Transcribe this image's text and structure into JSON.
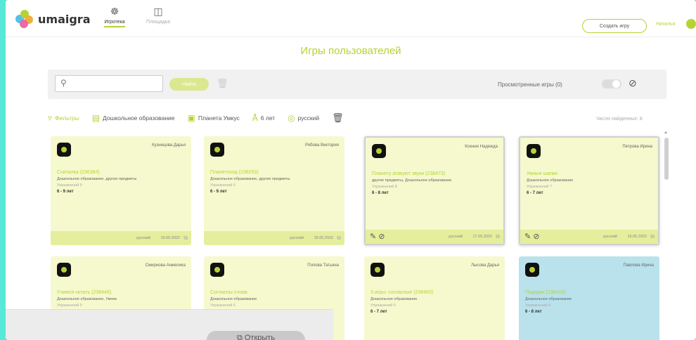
{
  "app": {
    "name": "umaigra"
  },
  "nav": [
    {
      "label": "Игротека",
      "icon": "games-icon"
    },
    {
      "label": "Площадка",
      "icon": "board-icon"
    }
  ],
  "header": {
    "create_button": "Создать игру",
    "user_name": "Наталья"
  },
  "page": {
    "title": "Игры пользователей"
  },
  "search": {
    "placeholder": "",
    "find_label": "Найти",
    "viewed_label": "Просмотренные игры (0)"
  },
  "filters": [
    {
      "label": "Фильтры",
      "icon": "funnel-icon",
      "accent": true
    },
    {
      "label": "Дошкольное образование",
      "icon": "book-icon",
      "accent": false
    },
    {
      "label": "Планета Умкус",
      "icon": "planet-icon",
      "accent": false
    },
    {
      "label": "6 лет",
      "icon": "age-icon",
      "accent": false
    },
    {
      "label": "русский",
      "icon": "globe-icon",
      "accent": false
    }
  ],
  "results_label": "Число найденных: 8",
  "cards": [
    {
      "author": "Кузнецова Дарья",
      "title": "Считалка (236384)",
      "subject": "Дошкольное образование, другие предметы",
      "exercises": "Упражнений 5",
      "age": "6 - 9 лет",
      "lang": "русский",
      "date": "19.05.2022",
      "selected": false,
      "color": "yellow"
    },
    {
      "author": "Рябова Виктория",
      "title": "Планетоход (238253)",
      "subject": "Дошкольное образование, другие предметы",
      "exercises": "Упражнений 6",
      "age": "6 - 9 лет",
      "lang": "русский",
      "date": "18.05.2022",
      "selected": false,
      "color": "yellow"
    },
    {
      "author": "Ксения Надежда",
      "title": "Планету атакуют звуки (238473)",
      "subject": "другие предметы, Дошкольное образование",
      "exercises": "Упражнений 8",
      "age": "6 - 8 лет",
      "lang": "русский",
      "date": "17.05.2022",
      "selected": true,
      "color": "yellow"
    },
    {
      "author": "Петрова Ирина",
      "title": "Умные шапки",
      "subject": "Дошкольное образование",
      "exercises": "Упражнений 7",
      "age": "6 - 7 лет",
      "lang": "русский",
      "date": "16.05.2022",
      "selected": true,
      "color": "yellow"
    },
    {
      "author": "Смирнова Анжелика",
      "title": "Учимся читать (238446)",
      "subject": "Дошкольное образование, Умник",
      "exercises": "Упражнений 5",
      "age": "",
      "lang": "",
      "date": "",
      "selected": false,
      "color": "yellow"
    },
    {
      "author": "Попова Татьяна",
      "title": "Согласны слова",
      "subject": "Дошкольное образование",
      "exercises": "Упражнений 6",
      "age": "",
      "lang": "",
      "date": "",
      "selected": false,
      "color": "yellow"
    },
    {
      "author": "Лысова Дарья",
      "title": "3 игры: согласные (238463)",
      "subject": "Дошкольное образование",
      "exercises": "Упражнений 6",
      "age": "6 - 7 лет",
      "lang": "",
      "date": "",
      "selected": false,
      "color": "yellow"
    },
    {
      "author": "Павлова Ирина",
      "title": "Подарки (238410)",
      "subject": "Дошкольное образование",
      "exercises": "Упражнений 4",
      "age": "6 - 8 лет",
      "lang": "",
      "date": "",
      "selected": false,
      "color": "blue"
    }
  ],
  "overlay": {
    "button_label": "Открыть"
  },
  "colors": {
    "accent": "#b5d334",
    "card": "#f5f9cd",
    "card_blue": "#b9e2ec",
    "frame_bg": "#57e8d8"
  }
}
